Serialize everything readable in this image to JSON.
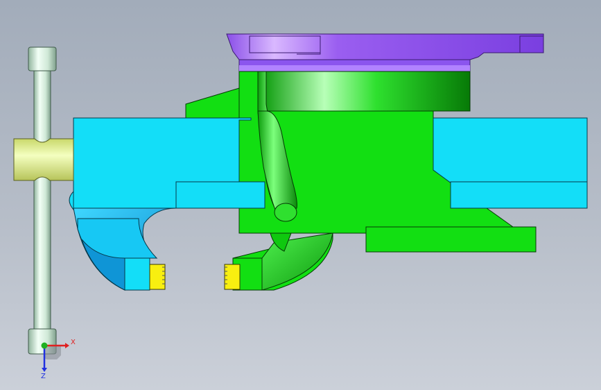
{
  "viewport": {
    "colors": {
      "jaw_body": "#13def8",
      "jaw_shade": "#0f95d6",
      "slide_body": "#12df12",
      "slide_shade": "#0a8f0a",
      "plate": "#9a5ef0",
      "plate_dark": "#6a2fd0",
      "handle": "#cfe8d6",
      "hub": "#e8f7a2",
      "jaw_pad": "#f8ef10"
    },
    "triad": {
      "x_label": "X",
      "z_label": "Z",
      "x_color": "#e02020",
      "y_color": "#20b020",
      "z_color": "#2030e0"
    }
  }
}
